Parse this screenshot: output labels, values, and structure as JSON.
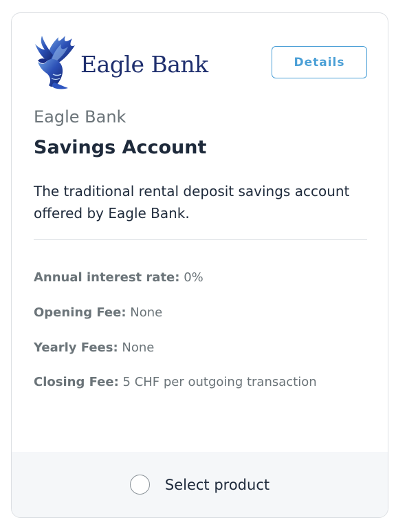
{
  "logo": {
    "name": "Eagle Bank",
    "icon": "eagle-icon"
  },
  "header": {
    "details_label": "Details"
  },
  "product": {
    "provider": "Eagle Bank",
    "title": "Savings Account",
    "description": "The traditional rental deposit savings account offered by Eagle Bank."
  },
  "features": [
    {
      "label": "Annual interest rate:",
      "value": "0%"
    },
    {
      "label": "Opening Fee:",
      "value": "None"
    },
    {
      "label": "Yearly Fees:",
      "value": "None"
    },
    {
      "label": "Closing Fee:",
      "value": "5 CHF per outgoing transaction"
    }
  ],
  "footer": {
    "select_label": "Select product",
    "selected": false
  },
  "colors": {
    "accent": "#4a9fd6",
    "brand": "#1f2f6e",
    "text": "#1e2a3b",
    "muted": "#6b7479",
    "footer_bg": "#f5f7f9"
  }
}
